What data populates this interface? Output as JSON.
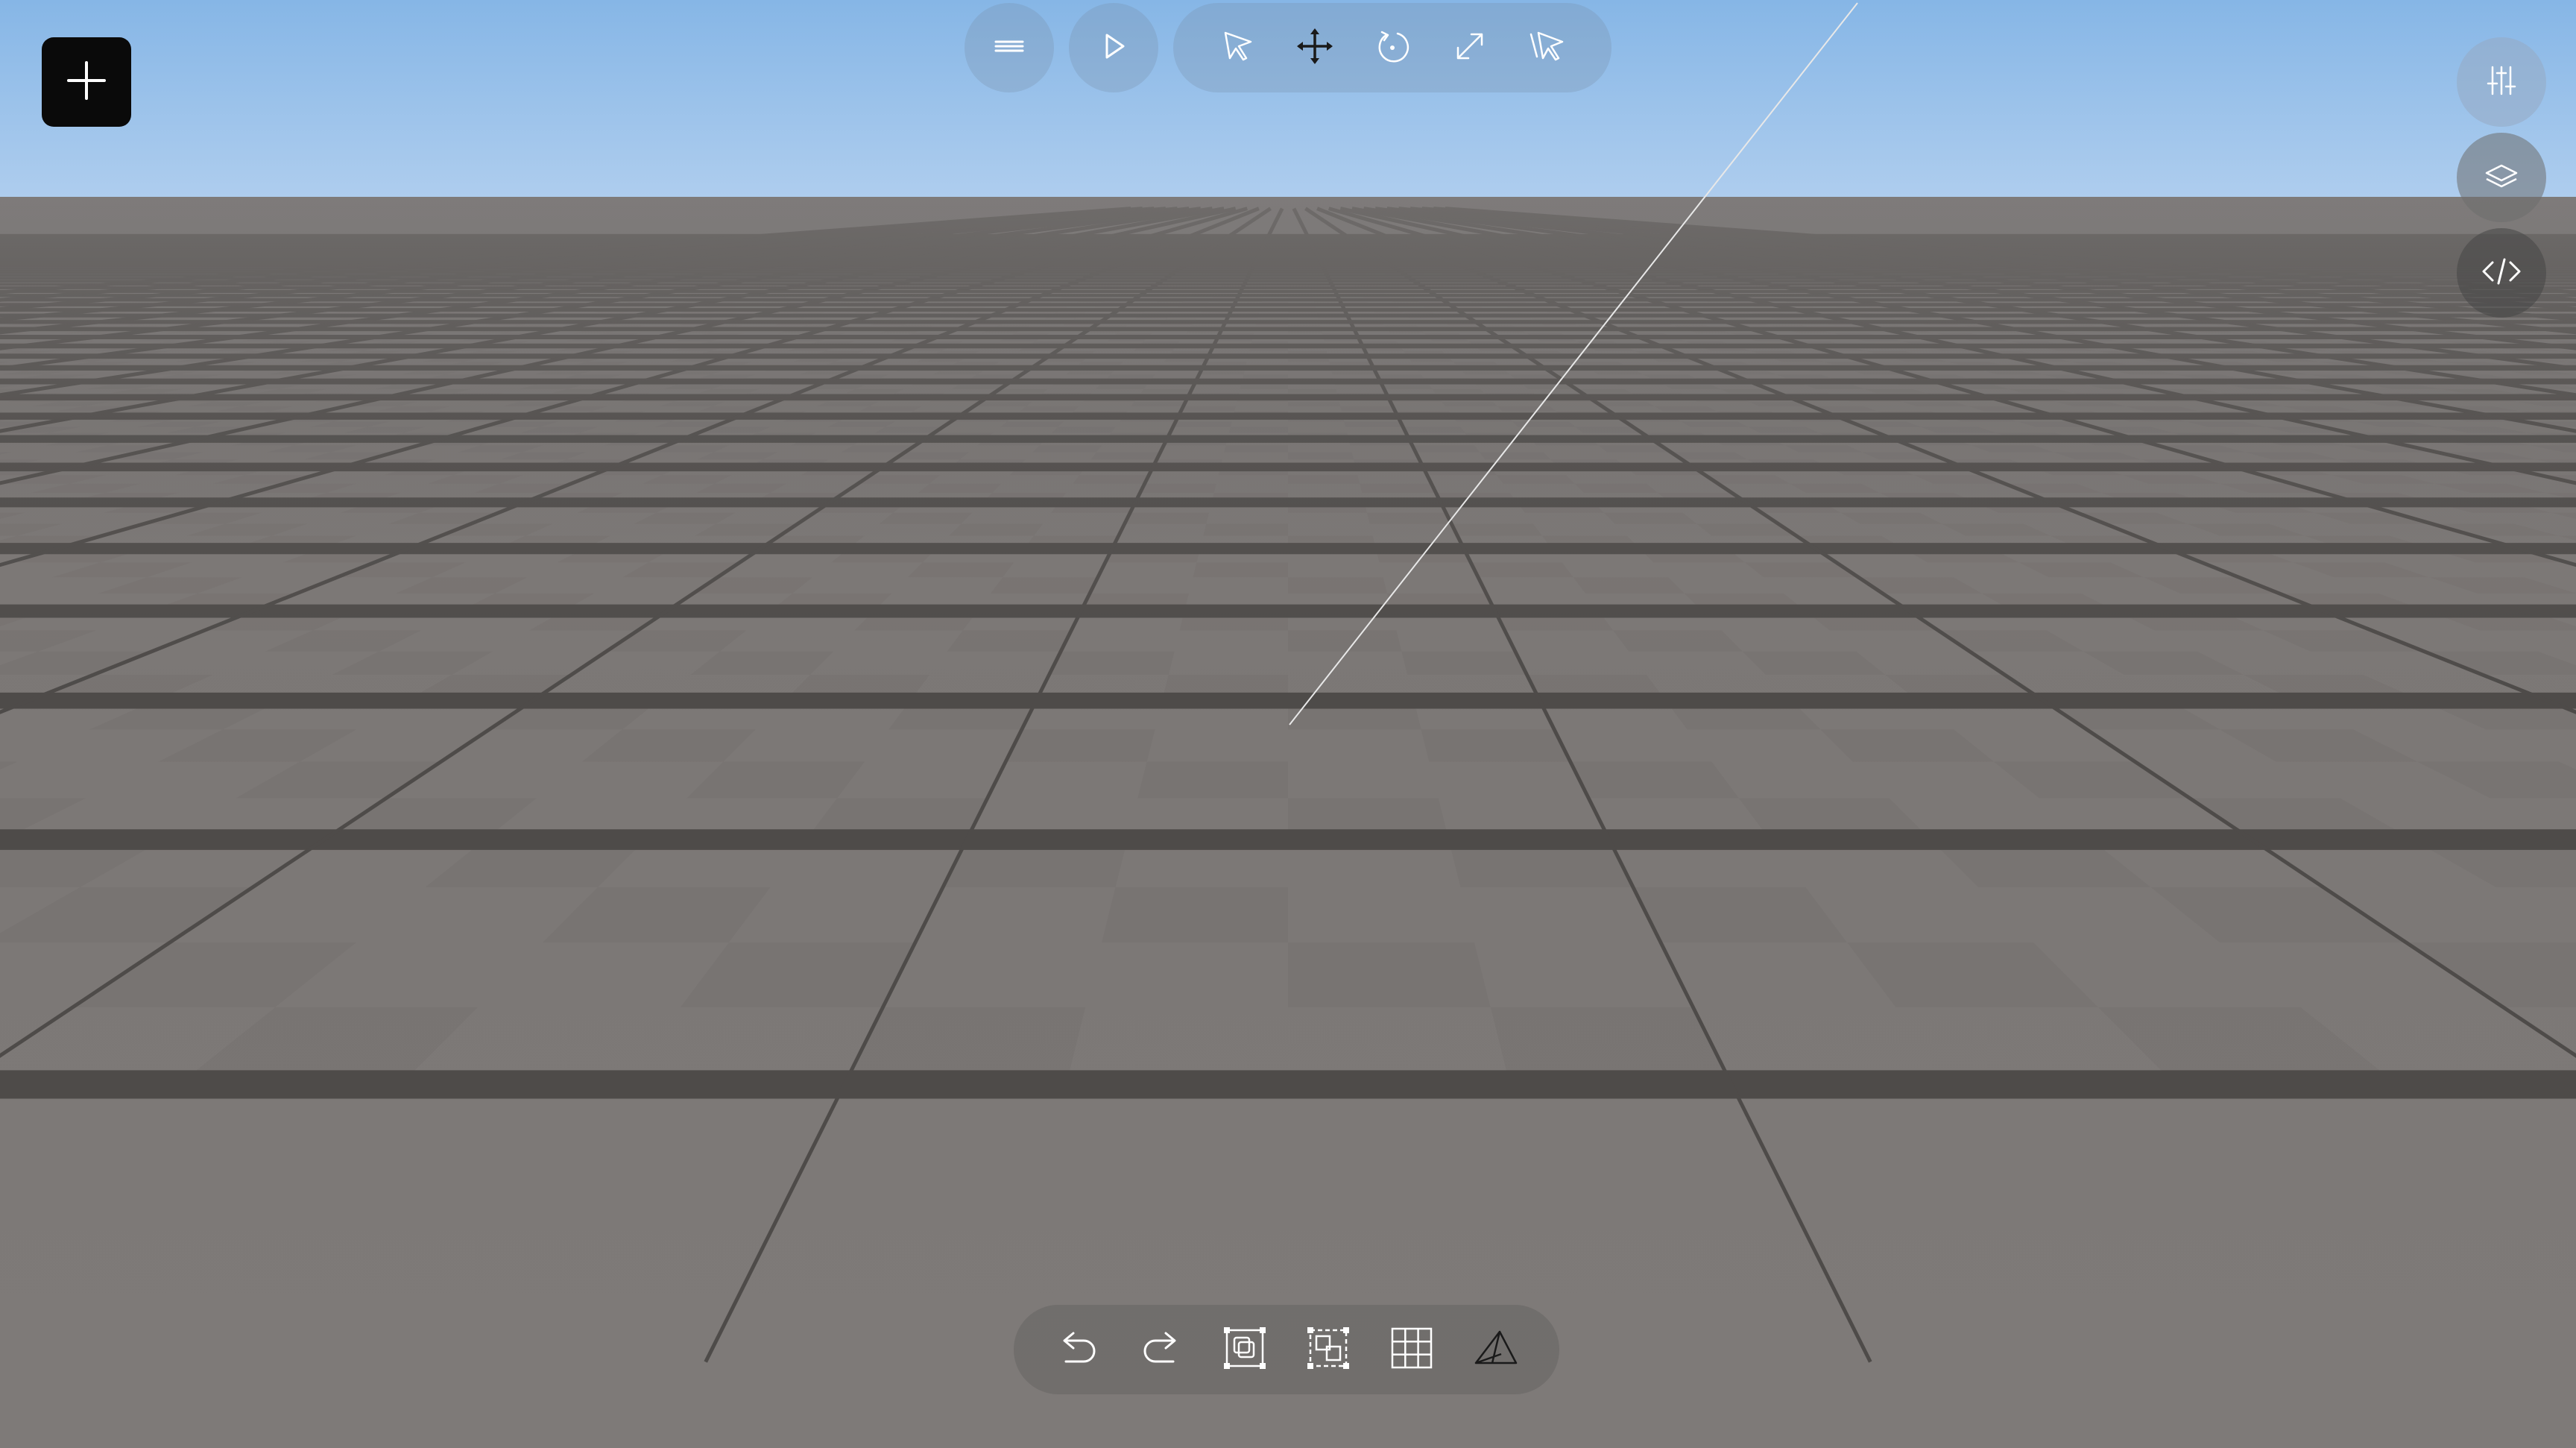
{
  "app": {
    "add_icon": "plus-icon"
  },
  "top_toolbar": {
    "menu_icon": "hamburger-icon",
    "play_icon": "play-icon",
    "tools": [
      "select-arrow-icon",
      "move-icon",
      "rotate-icon",
      "scale-icon",
      "multi-select-icon"
    ],
    "active_tool": "move"
  },
  "side_panel": {
    "buttons": [
      "sliders-icon",
      "layers-icon",
      "code-icon"
    ]
  },
  "bottom_toolbar": {
    "tools": [
      "undo-icon",
      "redo-icon",
      "duplicate-icon",
      "group-icon",
      "grid-icon",
      "camera-icon"
    ]
  },
  "colors": {
    "sky_top": "#86b6e6",
    "sky_bottom": "#aecdee",
    "floor": "#7a7674",
    "floor_line": "#4e4b49",
    "accent": "#0a0a0a"
  }
}
